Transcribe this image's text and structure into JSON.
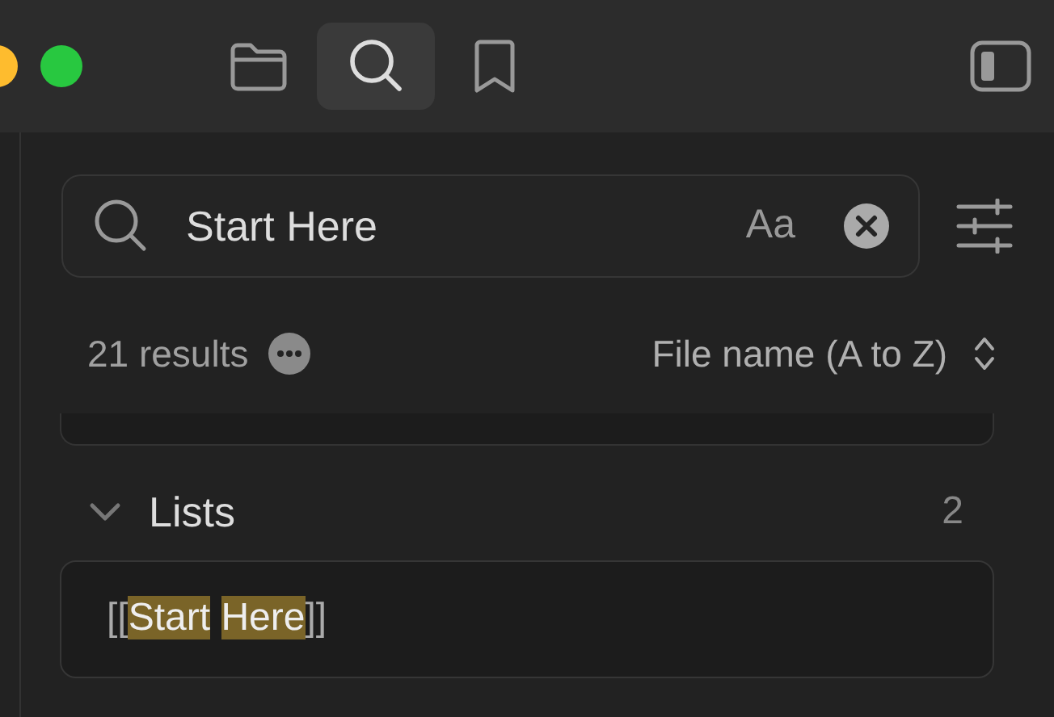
{
  "toolbar": {
    "tabs": [
      {
        "kind": "files",
        "selected": false
      },
      {
        "kind": "search",
        "selected": true
      },
      {
        "kind": "bookmarks",
        "selected": false
      }
    ]
  },
  "search": {
    "value": "Start Here",
    "case_toggle": "Aa"
  },
  "results": {
    "count": "21 results",
    "sort": "File name (A to Z)"
  },
  "groups": [
    {
      "title": "Lists",
      "count": "2",
      "expanded": true,
      "matches": [
        {
          "snippet": "[[**Start** **Here**]]"
        }
      ]
    }
  ]
}
